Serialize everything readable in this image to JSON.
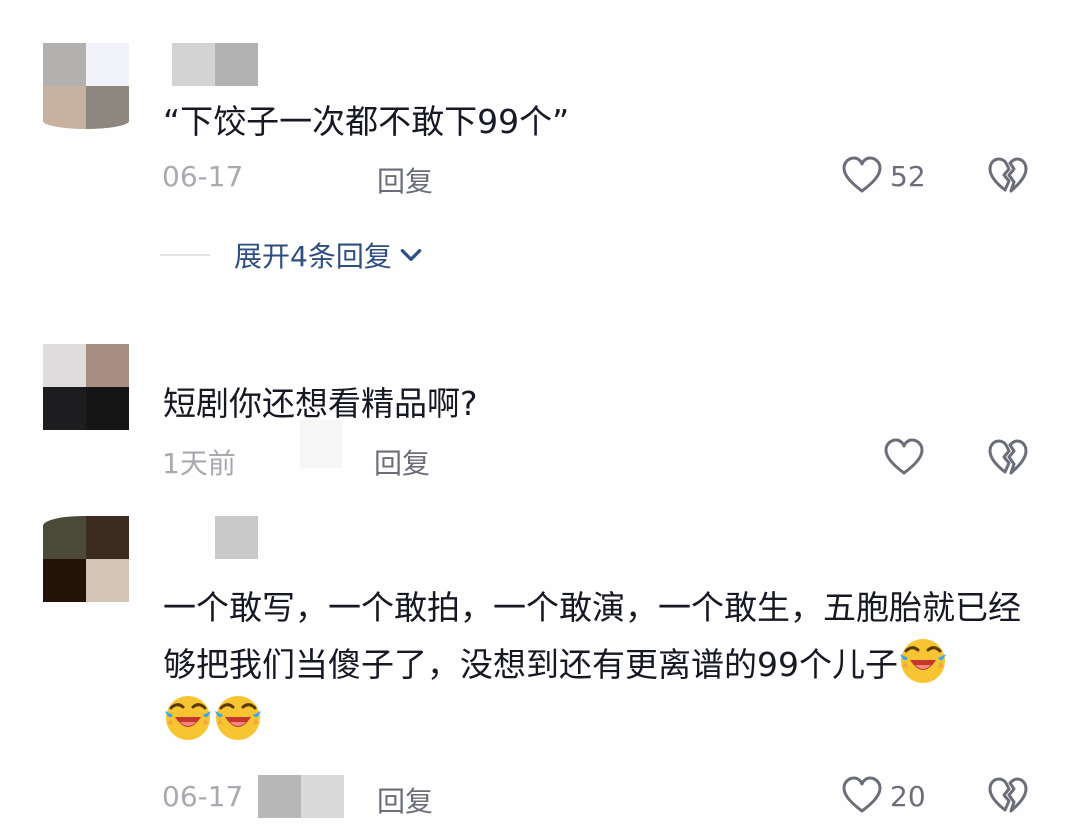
{
  "comments": [
    {
      "text": "“下饺子一次都不敢下99个”",
      "date": "06-17",
      "reply_label": "回复",
      "likes": "52",
      "expand_label": "展开4条回复"
    },
    {
      "text": "短剧你还想看精品啊?",
      "date": "1天前",
      "reply_label": "回复",
      "likes": ""
    },
    {
      "text_part1": "一个敢写，一个敢拍，一个敢演，一个敢生，五胞胎就已经够把我们当傻子了，没想到还有更离谱的99个儿子",
      "emoji_name": "laughing-crying-emoji",
      "date": "06-17",
      "reply_label": "回复",
      "likes": "20"
    }
  ],
  "icons": {
    "like": "heart-outline-icon",
    "dislike": "broken-heart-icon",
    "expand": "chevron-down-icon"
  },
  "colors": {
    "text": "#161823",
    "meta": "#a8aab0",
    "action": "#6b6e78",
    "link": "#2f4e83",
    "background": "#fefefe"
  }
}
